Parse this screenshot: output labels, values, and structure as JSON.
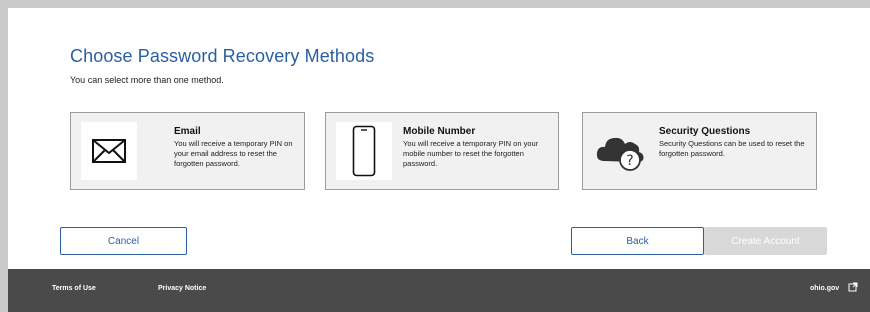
{
  "page": {
    "heading": "Choose Password Recovery Methods",
    "subtitle": "You can select more than one method."
  },
  "methods": [
    {
      "title": "Email",
      "description": "You will receive a temporary PIN on your email address to reset the forgotten password.",
      "icon": "envelope-icon"
    },
    {
      "title": "Mobile Number",
      "description": "You will receive a temporary PIN on your mobile number to reset the forgotten password.",
      "icon": "mobile-phone-icon"
    },
    {
      "title": "Security Questions",
      "description": "Security Questions can be used to reset the forgotten password.",
      "icon": "cloud-question-icon"
    }
  ],
  "actions": {
    "cancel_label": "Cancel",
    "back_label": "Back",
    "create_label": "Create Account"
  },
  "footer": {
    "terms": "Terms of Use",
    "privacy": "Privacy Notice",
    "ohio": "ohio.gov",
    "external_icon": "external-link-icon"
  },
  "colors": {
    "accent": "#2a5ea4",
    "footer_bg": "#4a4a4a",
    "card_bg": "#f1f1f1",
    "disabled_bg": "#d8d8d8"
  }
}
